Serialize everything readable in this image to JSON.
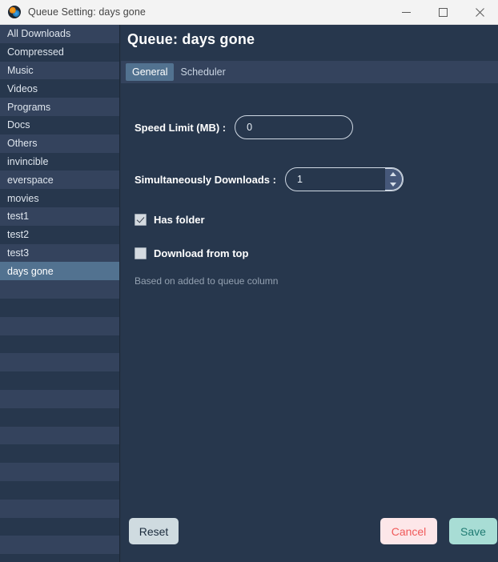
{
  "window": {
    "title": "Queue Setting: days gone",
    "app_icon": "globe-icon",
    "controls": {
      "minimize": "minimize-icon",
      "maximize": "maximize-icon",
      "close": "close-icon"
    }
  },
  "sidebar": {
    "items": [
      {
        "label": "All Downloads",
        "selected": false
      },
      {
        "label": "Compressed",
        "selected": false
      },
      {
        "label": "Music",
        "selected": false
      },
      {
        "label": "Videos",
        "selected": false
      },
      {
        "label": "Programs",
        "selected": false
      },
      {
        "label": "Docs",
        "selected": false
      },
      {
        "label": "Others",
        "selected": false
      },
      {
        "label": "invincible",
        "selected": false
      },
      {
        "label": "everspace",
        "selected": false
      },
      {
        "label": "movies",
        "selected": false
      },
      {
        "label": "test1",
        "selected": false
      },
      {
        "label": "test2",
        "selected": false
      },
      {
        "label": "test3",
        "selected": false
      },
      {
        "label": "days gone",
        "selected": true
      },
      {
        "label": "",
        "selected": false
      },
      {
        "label": "",
        "selected": false
      },
      {
        "label": "",
        "selected": false
      },
      {
        "label": "",
        "selected": false
      },
      {
        "label": "",
        "selected": false
      },
      {
        "label": "",
        "selected": false
      },
      {
        "label": "",
        "selected": false
      },
      {
        "label": "",
        "selected": false
      },
      {
        "label": "",
        "selected": false
      },
      {
        "label": "",
        "selected": false
      },
      {
        "label": "",
        "selected": false
      },
      {
        "label": "",
        "selected": false
      },
      {
        "label": "",
        "selected": false
      },
      {
        "label": "",
        "selected": false
      },
      {
        "label": "",
        "selected": false
      }
    ]
  },
  "main": {
    "page_title": "Queue: days gone",
    "tabs": [
      {
        "label": "General",
        "active": true
      },
      {
        "label": "Scheduler",
        "active": false
      }
    ],
    "fields": {
      "speed_limit": {
        "label": "Speed Limit (MB) :",
        "value": "0",
        "placeholder": ""
      },
      "simultaneous_downloads": {
        "label": "Simultaneously Downloads :",
        "value": "1",
        "placeholder": "",
        "spinner_up": "spinner-up-icon",
        "spinner_down": "spinner-down-icon"
      },
      "has_folder": {
        "label": "Has folder",
        "checked": true
      },
      "download_from_top": {
        "label": "Download from top",
        "checked": false
      }
    },
    "helper_text": "Based on added to queue column"
  },
  "footer": {
    "reset_label": "Reset",
    "cancel_label": "Cancel",
    "save_label": "Save"
  },
  "colors": {
    "background": "#27374d",
    "row_alt": "#34435d",
    "selection": "#527290",
    "titlebar": "#f3f3f3",
    "accent_save_bg": "#a8ddd5",
    "accent_save_text": "#1f7a72",
    "accent_cancel_bg": "#fde7e9",
    "accent_cancel_text": "#f05a5a",
    "reset_bg": "#cfdbe0"
  }
}
